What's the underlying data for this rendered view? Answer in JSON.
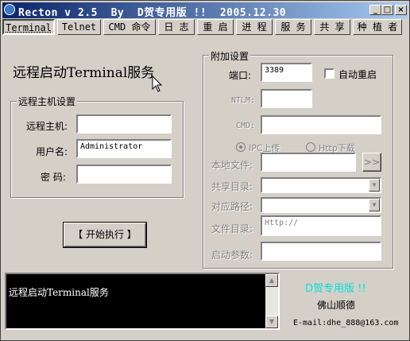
{
  "window": {
    "title": "Recton v 2.5  By  D贺专用版 !!  2005.12.30",
    "min_glyph": "_",
    "max_glyph": "□",
    "close_glyph": "×"
  },
  "tabs": [
    {
      "label": "Terminal",
      "active": true
    },
    {
      "label": "Telnet"
    },
    {
      "label": "CMD 命令"
    },
    {
      "label": "日 志"
    },
    {
      "label": "重 启"
    },
    {
      "label": "进 程"
    },
    {
      "label": "服 务"
    },
    {
      "label": "共 享"
    },
    {
      "label": "种 植 者"
    }
  ],
  "main": {
    "heading": "远程启动Terminal服务"
  },
  "remote_host_group": {
    "title": "远程主机设置",
    "host_label": "远程主机:",
    "host_value": "",
    "user_label": "用户名:",
    "user_value": "Administrator",
    "password_label": "密 码:",
    "password_value": ""
  },
  "start_button": {
    "label": "【 开始执行 】"
  },
  "extra_group": {
    "title": "附加设置",
    "port_label": "端口:",
    "port_value": "3389",
    "auto_restart_label": "自动重启",
    "ntlm_label": "NTLM:",
    "ntlm_value": "",
    "cmd_label": "CMD:",
    "cmd_value": "",
    "radio_ipc_label": "IPC上传",
    "radio_http_label": "Http下载",
    "local_file_label": "本地文件:",
    "browse_label": ">>",
    "share_dir_label": "共享目录:",
    "mapped_path_label": "对应路径:",
    "file_dir_label": "文件目录:",
    "file_dir_value": "Http://",
    "start_params_label": "启动参数:"
  },
  "log": {
    "text": "远程启动Terminal服务"
  },
  "brand": {
    "line1": "D贺专用版 !!",
    "line2": "佛山顺德",
    "line3": "E-mail:dhe_888@163.com",
    "accent_color": "#00e0e0"
  }
}
